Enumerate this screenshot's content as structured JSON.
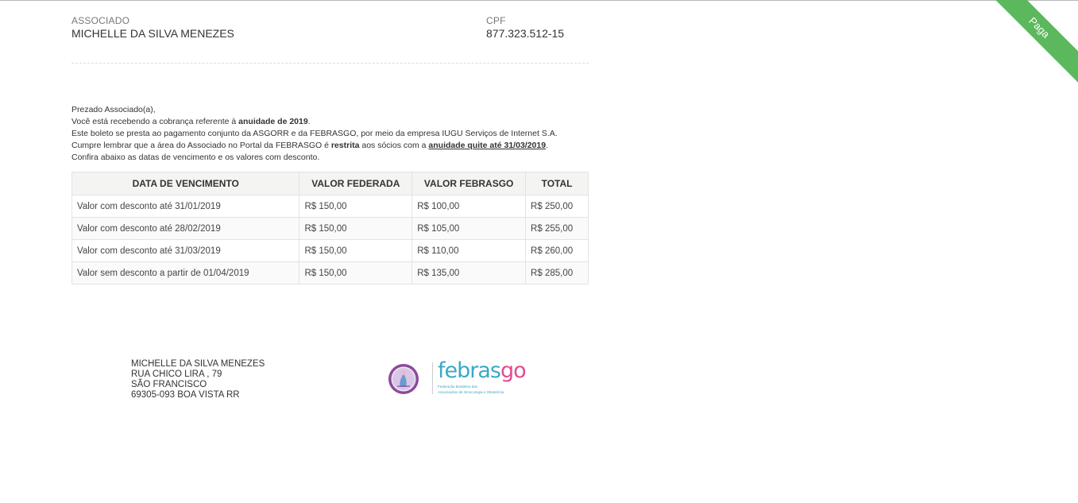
{
  "status_ribbon": "Paga",
  "associado": {
    "label": "ASSOCIADO",
    "value": "MICHELLE DA SILVA MENEZES"
  },
  "cpf": {
    "label": "CPF",
    "value": "877.323.512-15"
  },
  "message": {
    "greeting": "Prezado Associado(a),",
    "line2_a": "Você está recebendo a cobrança referente à ",
    "line2_b": "anuidade de 2019",
    "line2_c": ".",
    "line3": "Este boleto se presta ao pagamento conjunto da ASGORR e da FEBRASGO, por meio da empresa IUGU Serviços de Internet S.A.",
    "line4_a": "Cumpre lembrar que a área do Associado no Portal da FEBRASGO é ",
    "line4_b": "restrita",
    "line4_c": " aos sócios com a ",
    "line4_d": "anuidade quite até 31/03/2019",
    "line4_e": ".",
    "line5": "Confira abaixo as datas de vencimento e os valores com desconto."
  },
  "table": {
    "headers": [
      "DATA DE VENCIMENTO",
      "VALOR FEDERADA",
      "VALOR FEBRASGO",
      "TOTAL"
    ],
    "rows": [
      [
        "Valor com desconto até 31/01/2019",
        "R$ 150,00",
        "R$ 100,00",
        "R$ 250,00"
      ],
      [
        "Valor com desconto até 28/02/2019",
        "R$ 150,00",
        "R$ 105,00",
        "R$ 255,00"
      ],
      [
        "Valor com desconto até 31/03/2019",
        "R$ 150,00",
        "R$ 110,00",
        "R$ 260,00"
      ],
      [
        "Valor sem desconto a partir de 01/04/2019",
        "R$ 150,00",
        "R$ 135,00",
        "R$ 285,00"
      ]
    ]
  },
  "address": {
    "name": "MICHELLE DA SILVA MENEZES",
    "street": "RUA CHICO LIRA , 79",
    "district": "SÃO FRANCISCO",
    "city": "69305-093 BOA VISTA RR"
  },
  "logos": {
    "febrasgo_word_a": "febras",
    "febrasgo_word_b": "go",
    "febrasgo_sub_1": "Federação Brasileira das",
    "febrasgo_sub_2": "Associações de Ginecologia e Obstetrícia",
    "asgorr_color": "#8b4a9c",
    "febrasgo_color": "#3aa9c4",
    "febrasgo_accent": "#e54a8e"
  },
  "colors": {
    "ribbon": "#5cb85c"
  }
}
